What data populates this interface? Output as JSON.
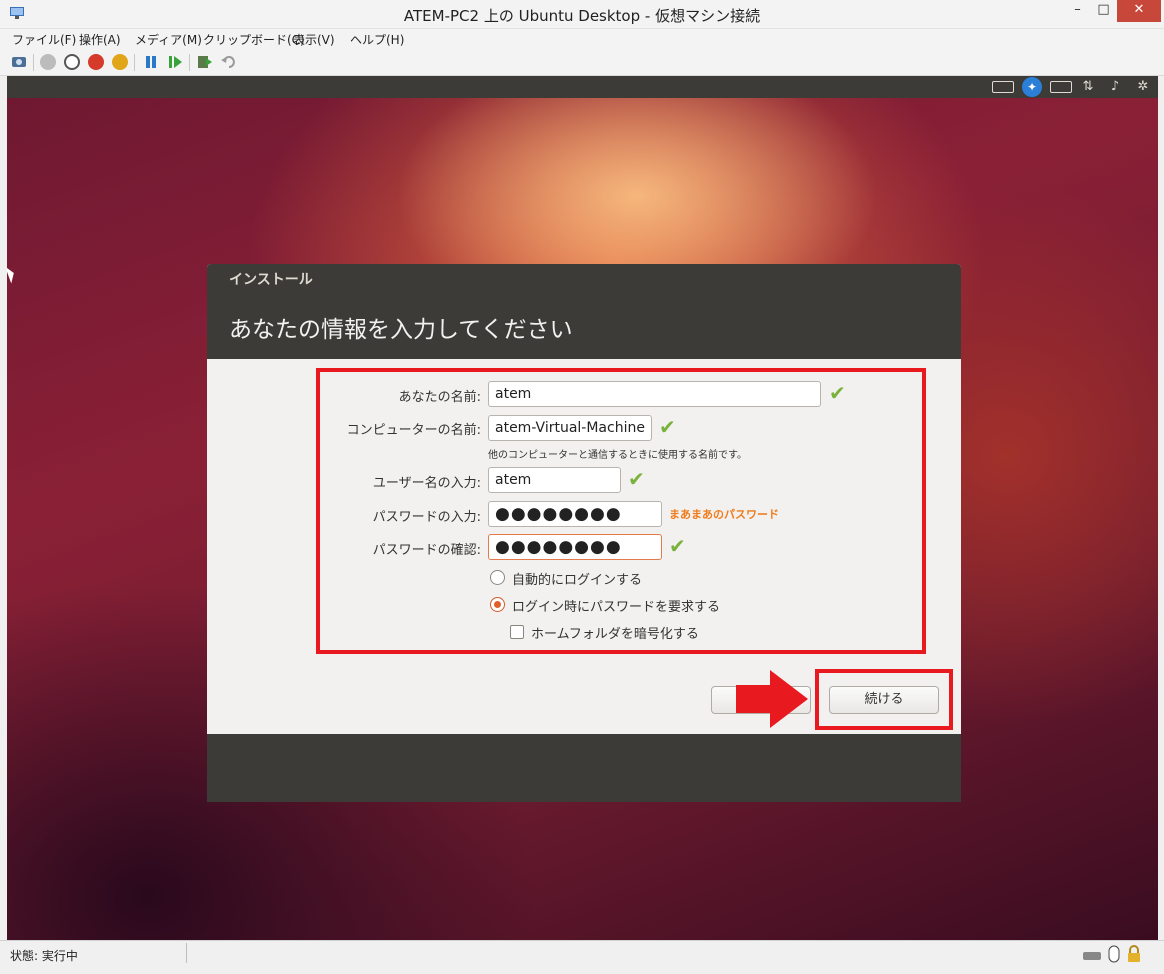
{
  "window": {
    "title": "ATEM-PC2 上の Ubuntu Desktop  - 仮想マシン接続",
    "minimize": "–",
    "maximize": "□",
    "close": "✕"
  },
  "menu": [
    "ファイル(F)",
    "操作(A)",
    "メディア(M)",
    "クリップボード(C)",
    "表示(V)",
    "ヘルプ(H)"
  ],
  "installer": {
    "small_title": "インストール",
    "main_title": "あなたの情報を入力してください",
    "name_label": "あなたの名前:",
    "name_value": "atem",
    "computer_label": "コンピューターの名前:",
    "computer_value": "atem-Virtual-Machine",
    "computer_hint": "他のコンピューターと通信するときに使用する名前です。",
    "username_label": "ユーザー名の入力:",
    "username_value": "atem",
    "password_label": "パスワードの入力:",
    "password_value": "●●●●●●●●",
    "password_strength": "まあまあのパスワード",
    "confirm_label": "パスワードの確認:",
    "confirm_value": "●●●●●●●●",
    "auto_login_label": "自動的にログインする",
    "require_password_label": "ログイン時にパスワードを要求する",
    "encrypt_home_label": "ホームフォルダを暗号化する",
    "back_label": "",
    "continue_label": "続ける",
    "check_mark": "✔"
  },
  "statusbar": {
    "text": "状態: 実行中"
  },
  "colors": {
    "annotation_red": "#e8191f",
    "ubuntu_orange": "#e15e2a",
    "panel_dark": "#3c3b37"
  }
}
